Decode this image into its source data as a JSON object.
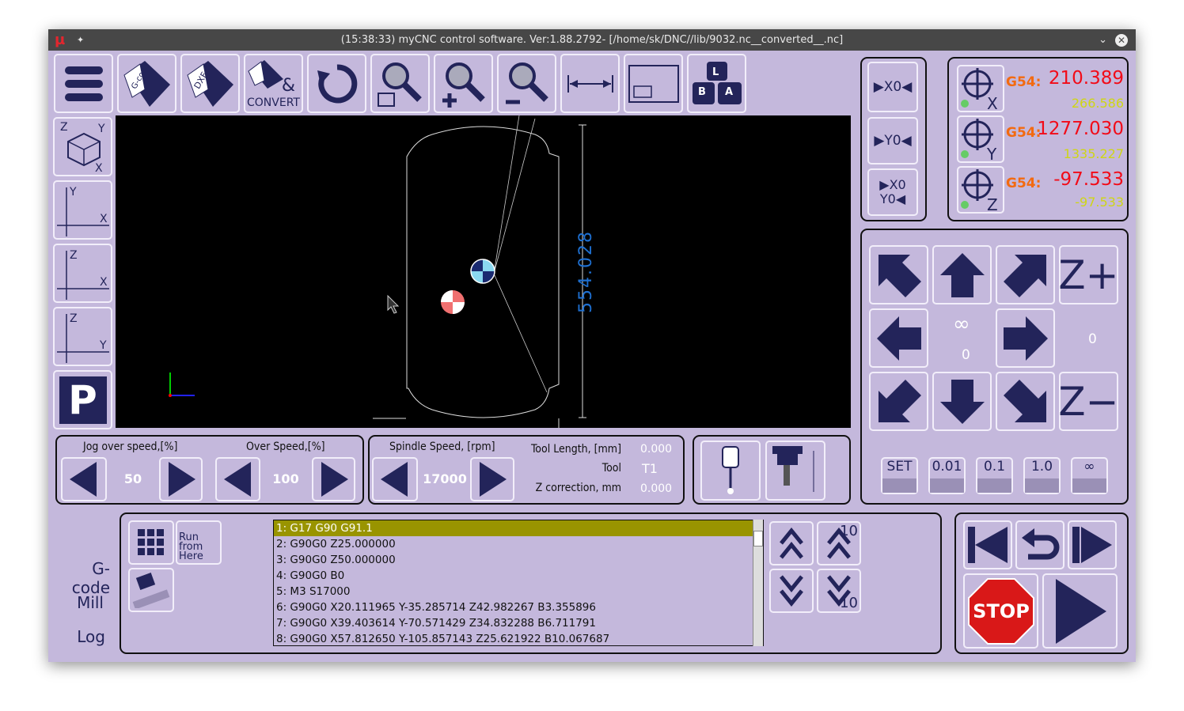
{
  "window": {
    "title": "(15:38:33) myCNC control software. Ver:1.88.2792- [/home/sk/DNC//lib/9032.nc__converted__.nc]",
    "app_icon": "mu-icon"
  },
  "toolbar": {
    "convert_label": "CONVERT",
    "gcode_label": "G-code",
    "dxf_label": "DXF",
    "amp": "&",
    "keys": [
      "L",
      "B",
      "A"
    ]
  },
  "view_buttons": {
    "iso": [
      "Z",
      "Y",
      "X"
    ],
    "xy": [
      "Y",
      "X"
    ],
    "zx": [
      "Z",
      "X"
    ],
    "zy": [
      "Z",
      "Y"
    ],
    "park": "P"
  },
  "viewport": {
    "dimension": "554.028",
    "accent": "#1e6fd0"
  },
  "zero_buttons": [
    "▶X0◀",
    "▶Y0◀",
    "▶X0 Y0◀"
  ],
  "coords": [
    {
      "axis": "X",
      "offset": "G54:",
      "machine": "210.389",
      "work": "266.586"
    },
    {
      "axis": "Y",
      "offset": "G54:",
      "machine": "1277.030",
      "work": "1335.227"
    },
    {
      "axis": "Z",
      "offset": "G54:",
      "machine": "-97.533",
      "work": "-97.533"
    }
  ],
  "jog": {
    "zplus": "Z+",
    "zminus": "Z−",
    "infinity": "∞",
    "center_value": "0",
    "right_value": "0",
    "steps": [
      "SET",
      "0.01",
      "0.1",
      "1.0",
      "∞"
    ]
  },
  "speed": {
    "jog_label": "Jog over speed,[%]",
    "jog_value": "50",
    "over_label": "Over Speed,[%]",
    "over_value": "100",
    "spindle_label": "Spindle Speed, [rpm]",
    "spindle_value": "17000"
  },
  "tool": {
    "length_label": "Tool Length, [mm]",
    "length_value": "0.000",
    "tool_label": "Tool",
    "tool_value": "T1",
    "zcorr_label": "Z correction, mm",
    "zcorr_value": "0.000"
  },
  "side_tabs": [
    "G-code",
    "Mill",
    "Log"
  ],
  "gcode": {
    "run_from_here": "Run from Here",
    "lines": [
      "1: G17 G90 G91.1",
      "2: G90G0 Z25.000000",
      "3: G90G0 Z50.000000",
      "4: G90G0 B0",
      "5: M3 S17000",
      "6: G90G0 X20.111965 Y-35.285714 Z42.982267 B3.355896",
      "7: G90G0 X39.403614 Y-70.571429 Z34.832288 B6.711791",
      "8: G90G0 X57.812650 Y-105.857143 Z25.621922 B10.067687"
    ],
    "selected": 0,
    "page_step": "10"
  },
  "run": {
    "stop_label": "STOP"
  },
  "colors": {
    "background": "#c4b8dc",
    "icon": "#23245a",
    "selected_row": "#999400",
    "machine_coord": "#f20b18",
    "work_coord": "#cfd615",
    "offset": "#f36a10"
  }
}
